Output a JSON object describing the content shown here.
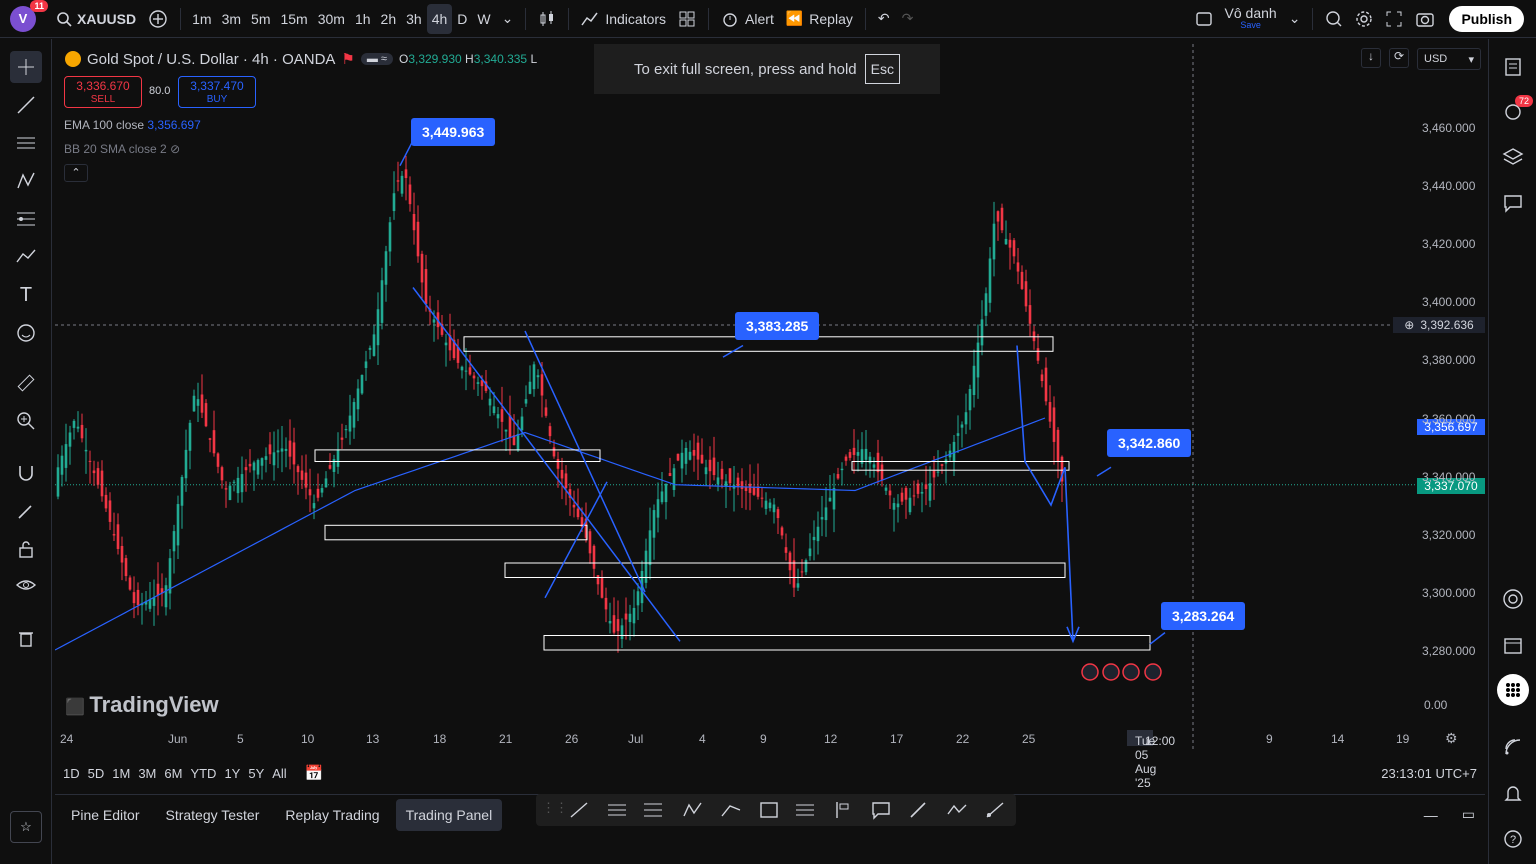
{
  "topbar": {
    "avatar_letter": "V",
    "avatar_badge": "11",
    "symbol": "XAUUSD",
    "timeframes": [
      "1m",
      "3m",
      "5m",
      "15m",
      "30m",
      "1h",
      "2h",
      "3h",
      "4h",
      "D",
      "W"
    ],
    "active_timeframe": "4h",
    "indicators_label": "Indicators",
    "alert_label": "Alert",
    "replay_label": "Replay",
    "layout_name": "Vô danh",
    "save_label": "Save",
    "publish_label": "Publish"
  },
  "chart": {
    "title": "Gold Spot / U.S. Dollar · 4h · OANDA",
    "ohlc": {
      "o": "3,329.930",
      "h": "3,340.335",
      "l": "L"
    },
    "sell_price": "3,336.670",
    "sell_label": "SELL",
    "buy_price": "3,337.470",
    "buy_label": "BUY",
    "spread": "80.0",
    "ema_label": "EMA 100 close",
    "ema_value": "3,356.697",
    "bb_label": "BB 20 SMA close 2",
    "currency": "USD",
    "watermark": "TradingView",
    "colors": {
      "up": "#22ab94",
      "down": "#f23645",
      "accent": "#2962ff",
      "ema": "#2962ff"
    }
  },
  "toast": {
    "text": "To exit full screen, press and hold",
    "key": "Esc"
  },
  "callouts": [
    "3,449.963",
    "3,383.285",
    "3,342.860",
    "3,283.264"
  ],
  "price_axis": {
    "labels": [
      "3,460.000",
      "3,440.000",
      "3,420.000",
      "3,400.000",
      "3,380.000",
      "3,360.000",
      "3,340.000",
      "3,320.000",
      "3,300.000",
      "3,280.000",
      "0.00"
    ],
    "crosshair_price": "3,392.636",
    "ema_tag": "3,356.697",
    "last_price_tag": "3,337.070"
  },
  "time_axis": {
    "labels": [
      "24",
      "Jun",
      "5",
      "10",
      "13",
      "18",
      "21",
      "26",
      "Jul",
      "4",
      "9",
      "12",
      "17",
      "22",
      "25",
      "9",
      "14",
      "19"
    ],
    "crosshair_time": "Tue 05 Aug '25",
    "crosshair_clock": "12:00"
  },
  "bottom": {
    "ranges": [
      "1D",
      "5D",
      "1M",
      "3M",
      "6M",
      "YTD",
      "1Y",
      "5Y",
      "All"
    ],
    "clock": "23:13:01 UTC+7"
  },
  "panel_tabs": [
    "Pine Editor",
    "Strategy Tester",
    "Replay Trading",
    "Trading Panel"
  ],
  "active_panel": "Trading Panel",
  "right_badge": "72"
}
